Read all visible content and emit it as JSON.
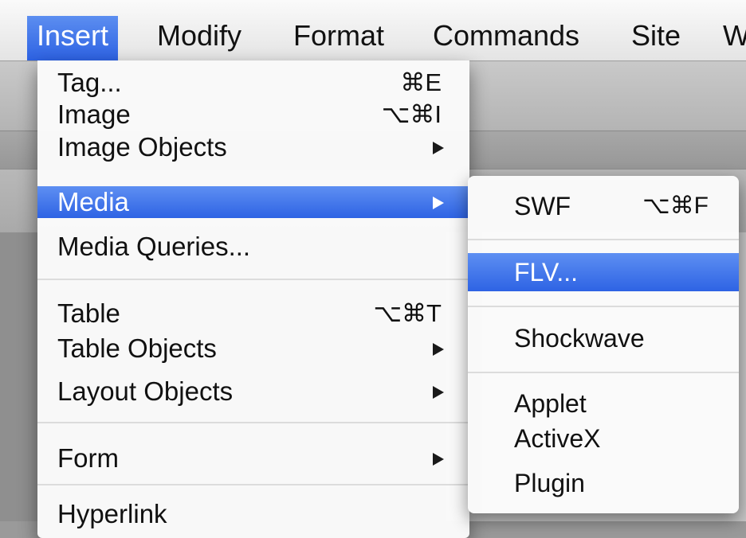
{
  "menubar": {
    "items": [
      "Insert",
      "Modify",
      "Format",
      "Commands",
      "Site",
      "W"
    ]
  },
  "insert_menu": {
    "items": [
      {
        "label": "Tag...",
        "shortcut": "⌘E"
      },
      {
        "label": "Image",
        "shortcut": "⌥⌘I"
      },
      {
        "label": "Image Objects",
        "submenu": true
      },
      {
        "label": "Media",
        "submenu": true,
        "selected": true
      },
      {
        "label": "Media Queries..."
      },
      {
        "label": "Table",
        "shortcut": "⌥⌘T"
      },
      {
        "label": "Table Objects",
        "submenu": true
      },
      {
        "label": "Layout Objects",
        "submenu": true
      },
      {
        "label": "Form",
        "submenu": true
      },
      {
        "label": "Hyperlink"
      }
    ]
  },
  "media_submenu": {
    "items": [
      {
        "label": "SWF",
        "shortcut": "⌥⌘F"
      },
      {
        "label": "FLV...",
        "selected": true
      },
      {
        "label": "Shockwave"
      },
      {
        "label": "Applet"
      },
      {
        "label": "ActiveX"
      },
      {
        "label": "Plugin"
      }
    ]
  },
  "colors": {
    "selection": "#3a6fe8",
    "menu_bg": "#fafafa"
  }
}
